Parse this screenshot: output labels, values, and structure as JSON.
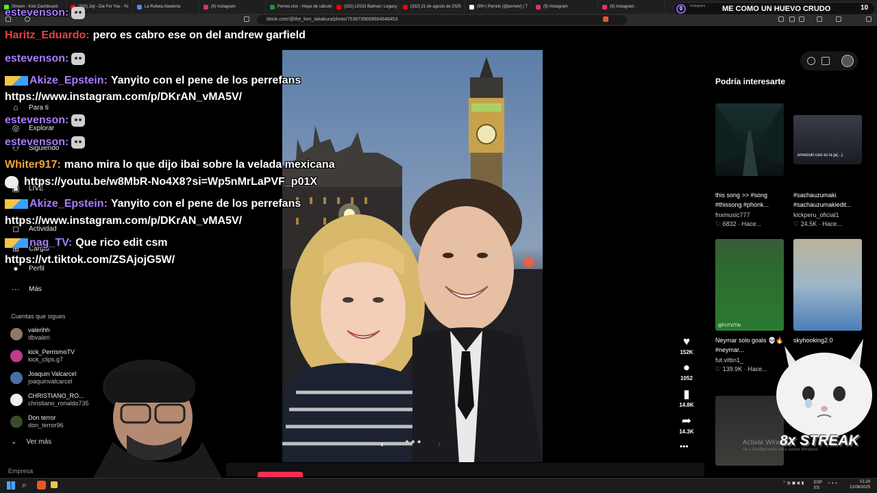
{
  "browser": {
    "tabs": [
      {
        "label": "Stream - Kick Dashboard",
        "color": "#53fc18"
      },
      {
        "label": "(332) Joji - Die For You - Yo",
        "color": "#ff0000"
      },
      {
        "label": "La Rulieta Aleatoria",
        "color": "#4b8bf5"
      },
      {
        "label": "(9) Instagram",
        "color": "#e1306c"
      },
      {
        "label": "Perreo.xlsx - Hojas de cálculo",
        "color": "#1e8e3e"
      },
      {
        "label": "(332) LEGO Batman: Legacy",
        "color": "#ff0000"
      },
      {
        "label": "(332) 21 de agosto de 2025",
        "color": "#ff0000"
      },
      {
        "label": "(99+) Perretv (@perretv) | T",
        "color": "#ffffff"
      },
      {
        "label": "(9) Instagram",
        "color": "#e1306c"
      },
      {
        "label": "(9) Instagram",
        "color": "#e1306c"
      }
    ],
    "url": "tiktok.com/@the_ken_takakura/photo/7538739669664648453"
  },
  "stream_overlay": {
    "left_count": "0",
    "small_label": "Instagram",
    "title": "ME COMO UN HUEVO CRUDO",
    "right_count": "10"
  },
  "sidebar": {
    "items": [
      {
        "label": "Para ti",
        "icon": "home-icon"
      },
      {
        "label": "Explorar",
        "icon": "compass-icon"
      },
      {
        "label": "Siguiendo",
        "icon": "users-icon"
      },
      {
        "label": "LIVE",
        "icon": "live-icon"
      },
      {
        "label": "Actividad",
        "icon": "bell-icon"
      },
      {
        "label": "Cargar",
        "icon": "plus-icon"
      },
      {
        "label": "Perfil",
        "icon": "avatar-icon"
      },
      {
        "label": "Más",
        "icon": "dots-icon"
      }
    ],
    "following_title": "Cuentas que sigues",
    "following": [
      {
        "name": "valerihh",
        "handle": "dbvaleri"
      },
      {
        "name": "kick_PerrismoTV",
        "handle": "kick_clips.g7"
      },
      {
        "name": "Joaquin Valcarcel",
        "handle": "joaquinvalcarcel"
      },
      {
        "name": "CHRISTIANO_RO...",
        "handle": "christiano_ronaldo735"
      },
      {
        "name": "Don terror",
        "handle": "don_terror96"
      }
    ],
    "see_more": "Ver más",
    "company": "Empresa"
  },
  "actions": {
    "likes": "152K",
    "comments": "1052",
    "saves": "14.8K",
    "shares": "14.3K"
  },
  "recommendations": {
    "title": "Podría interesarte",
    "cards": [
      {
        "title": "this song >> #song #thissong #phonk...",
        "user": "fnxmusic777",
        "likes": "6832",
        "time": "Hace..."
      },
      {
        "title": "#sachauzumaki #sachauzumakiedit...",
        "user": "kickperu_oficial1",
        "likes": "24.5K",
        "time": "Hace..."
      },
      {
        "title": "Neymar solo goals 💀🔥 #neymar...",
        "user": "fut.vittin1_",
        "likes": "139.9K",
        "time": "Hace..."
      },
      {
        "title": "skyhooking2.0",
        "user": "",
        "likes": "",
        "time": ""
      }
    ],
    "thumb_caption_2": "emetzuki casi es la ja(...)",
    "thumb_caption_3": "@FUTVITIN"
  },
  "chat": [
    {
      "user": "estevenson:",
      "msg": "",
      "emote": true,
      "color": "purple"
    },
    {
      "user": "Haritz_Eduardo:",
      "msg": "pero es cabro ese on del andrew garfield",
      "emote": false,
      "color": "red"
    },
    {
      "user": "estevenson:",
      "msg": "",
      "emote": true,
      "color": "purple"
    },
    {
      "user": "Akize_Epstein:",
      "msg": "Yanyito con el pene de los perrefans",
      "emote": false,
      "color": "purple",
      "badges": true
    },
    {
      "user": "",
      "msg": "https://www.instagram.com/p/DKrAN_vMA5V/",
      "emote": false,
      "color": "purple"
    },
    {
      "user": "estevenson:",
      "msg": "",
      "emote": true,
      "color": "purple"
    },
    {
      "user": "estevenson:",
      "msg": "",
      "emote": true,
      "color": "purple"
    },
    {
      "user": "Whiter917:",
      "msg": "mano mira lo que dijo ibai sobre la velada mexicana",
      "emote": false,
      "color": "orange"
    },
    {
      "user": "",
      "msg": "https://youtu.be/w8MbR-No4X8?si=Wp5nMrLaPVF_p01X",
      "emote": false,
      "color": "purple",
      "skull": true
    },
    {
      "user": "Akize_Epstein:",
      "msg": "Yanyito con el pene de los perrefans",
      "emote": false,
      "color": "purple",
      "badges": true
    },
    {
      "user": "",
      "msg": "https://www.instagram.com/p/DKrAN_vMA5V/",
      "emote": false,
      "color": "purple"
    },
    {
      "user": "nag_TV:",
      "msg": "Que rico edit csm",
      "emote": false,
      "color": "purple",
      "badges": true
    },
    {
      "user": "",
      "msg": "https://vt.tiktok.com/ZSAjojG5W/",
      "emote": false,
      "color": "purple"
    }
  ],
  "streak": {
    "text": "8x STREAK",
    "watermark1": "Activar Windows",
    "watermark2": "Ve a Configuración para activar Windows."
  },
  "taskbar": {
    "lang1": "ESP",
    "lang2": "ES",
    "time": "01:24",
    "date": "21/08/2025"
  }
}
